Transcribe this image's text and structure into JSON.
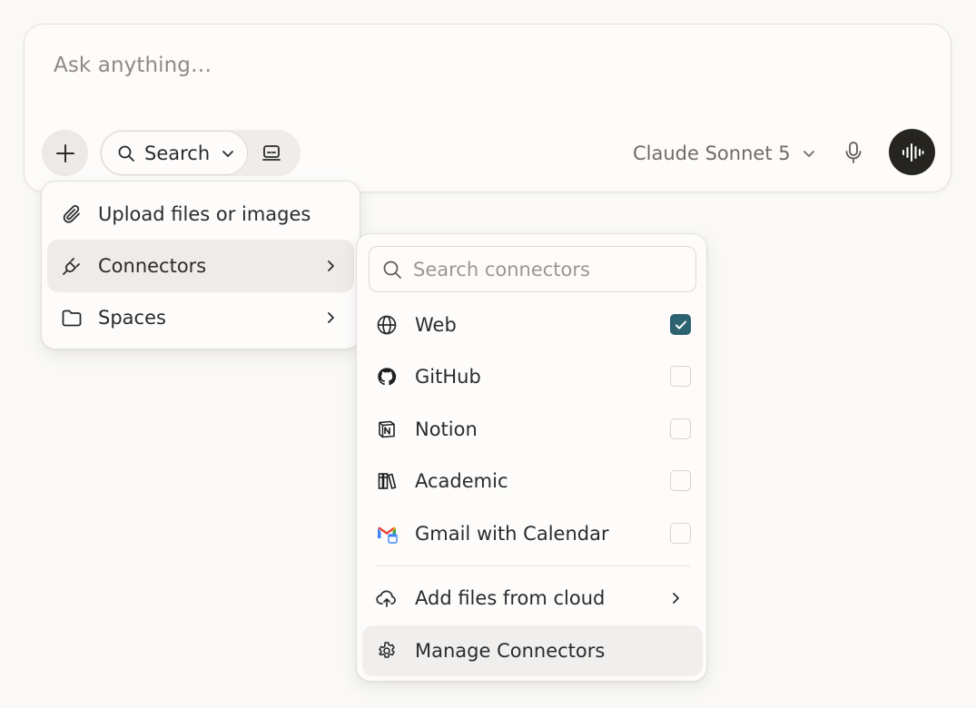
{
  "composer": {
    "placeholder": "Ask anything…",
    "search_mode_label": "Search",
    "model_label": "Claude Sonnet 5"
  },
  "attach_menu": {
    "items": [
      {
        "label": "Upload files or images",
        "icon": "paperclip-icon"
      },
      {
        "label": "Connectors",
        "icon": "plug-icon",
        "has_submenu": true,
        "active": true
      },
      {
        "label": "Spaces",
        "icon": "folder-icon",
        "has_submenu": true
      }
    ]
  },
  "connectors_menu": {
    "search_placeholder": "Search connectors",
    "items": [
      {
        "label": "Web",
        "icon": "globe-icon",
        "checked": true
      },
      {
        "label": "GitHub",
        "icon": "github-icon",
        "checked": false
      },
      {
        "label": "Notion",
        "icon": "notion-icon",
        "checked": false
      },
      {
        "label": "Academic",
        "icon": "books-icon",
        "checked": false
      },
      {
        "label": "Gmail with Calendar",
        "icon": "gmail-icon",
        "checked": false
      }
    ],
    "footer": [
      {
        "label": "Add files from cloud",
        "icon": "cloud-upload-icon",
        "has_submenu": true
      },
      {
        "label": "Manage Connectors",
        "icon": "gear-icon"
      }
    ]
  },
  "colors": {
    "checkbox_checked": "#2d6370",
    "voice_button": "#26241f",
    "background": "#faf9f7"
  }
}
